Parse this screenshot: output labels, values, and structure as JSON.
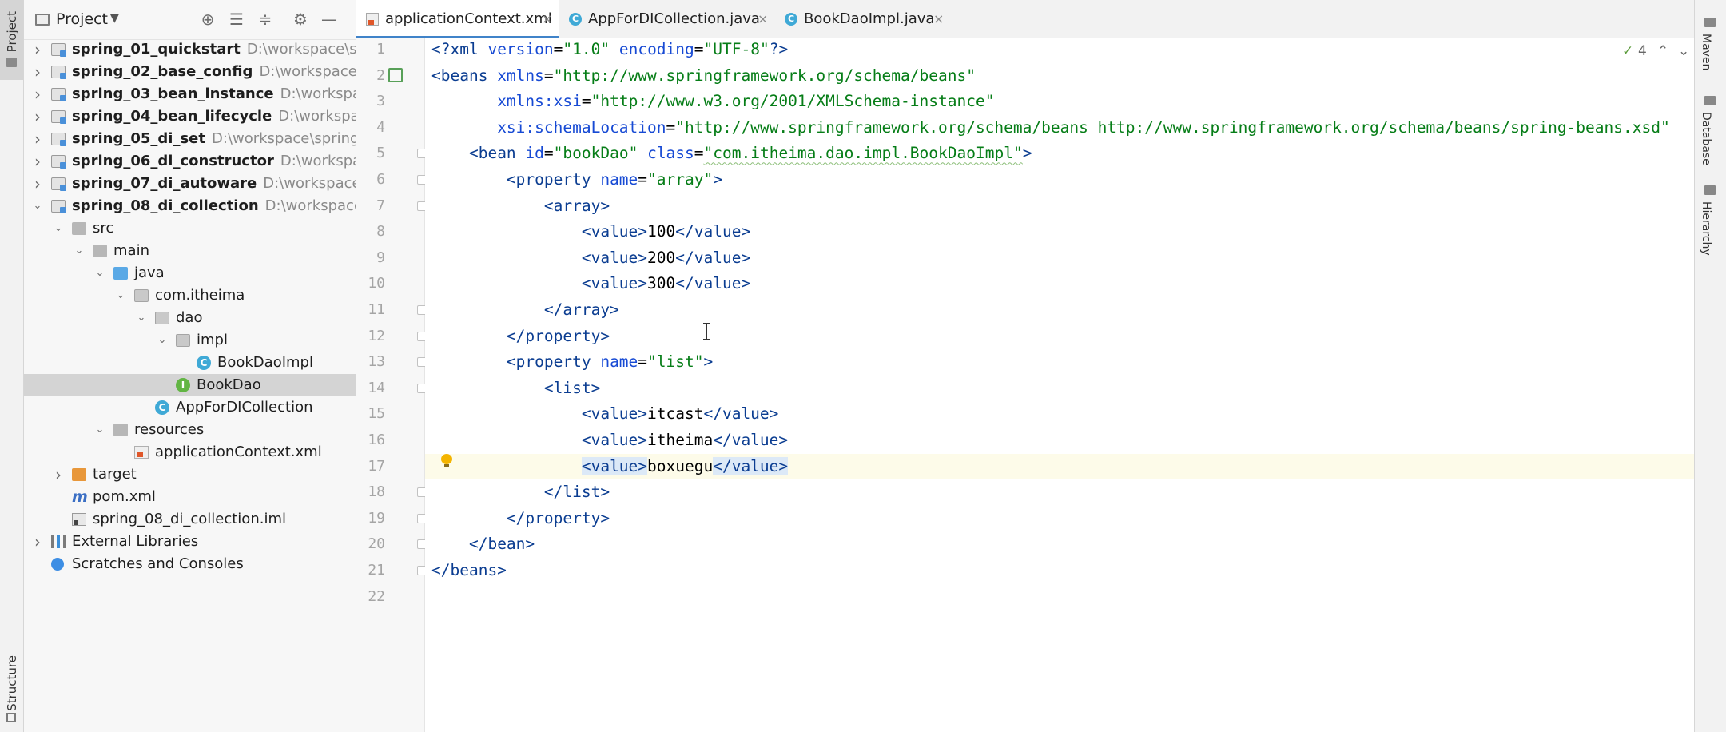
{
  "left_stripe": {
    "project_label": "Project",
    "structure_label": "Structure"
  },
  "project_panel": {
    "title": "Project",
    "tree": [
      {
        "label": "spring_01_quickstart",
        "path": "D:\\workspace\\spri",
        "bold": true,
        "indent": 0,
        "arrow": "right",
        "icon": "module"
      },
      {
        "label": "spring_02_base_config",
        "path": "D:\\workspace\\sp",
        "bold": true,
        "indent": 0,
        "arrow": "right",
        "icon": "module"
      },
      {
        "label": "spring_03_bean_instance",
        "path": "D:\\workspace\\",
        "bold": true,
        "indent": 0,
        "arrow": "right",
        "icon": "module"
      },
      {
        "label": "spring_04_bean_lifecycle",
        "path": "D:\\workspace\\",
        "bold": true,
        "indent": 0,
        "arrow": "right",
        "icon": "module"
      },
      {
        "label": "spring_05_di_set",
        "path": "D:\\workspace\\spring\\s",
        "bold": true,
        "indent": 0,
        "arrow": "right",
        "icon": "module"
      },
      {
        "label": "spring_06_di_constructor",
        "path": "D:\\workspace",
        "bold": true,
        "indent": 0,
        "arrow": "right",
        "icon": "module"
      },
      {
        "label": "spring_07_di_autoware",
        "path": "D:\\workspace\\sp",
        "bold": true,
        "indent": 0,
        "arrow": "right",
        "icon": "module"
      },
      {
        "label": "spring_08_di_collection",
        "path": "D:\\workspace\\s",
        "bold": true,
        "indent": 0,
        "arrow": "down",
        "icon": "module"
      },
      {
        "label": "src",
        "path": "",
        "bold": false,
        "indent": 1,
        "arrow": "down",
        "icon": "folder"
      },
      {
        "label": "main",
        "path": "",
        "bold": false,
        "indent": 2,
        "arrow": "down",
        "icon": "folder"
      },
      {
        "label": "java",
        "path": "",
        "bold": false,
        "indent": 3,
        "arrow": "down",
        "icon": "folder-blue"
      },
      {
        "label": "com.itheima",
        "path": "",
        "bold": false,
        "indent": 4,
        "arrow": "down",
        "icon": "pkg"
      },
      {
        "label": "dao",
        "path": "",
        "bold": false,
        "indent": 5,
        "arrow": "down",
        "icon": "pkg"
      },
      {
        "label": "impl",
        "path": "",
        "bold": false,
        "indent": 6,
        "arrow": "down",
        "icon": "pkg"
      },
      {
        "label": "BookDaoImpl",
        "path": "",
        "bold": false,
        "indent": 7,
        "arrow": "",
        "icon": "class"
      },
      {
        "label": "BookDao",
        "path": "",
        "bold": false,
        "indent": 6,
        "arrow": "",
        "icon": "iface",
        "selected": true
      },
      {
        "label": "AppForDICollection",
        "path": "",
        "bold": false,
        "indent": 5,
        "arrow": "",
        "icon": "class"
      },
      {
        "label": "resources",
        "path": "",
        "bold": false,
        "indent": 3,
        "arrow": "down",
        "icon": "folder"
      },
      {
        "label": "applicationContext.xml",
        "path": "",
        "bold": false,
        "indent": 4,
        "arrow": "",
        "icon": "xml"
      },
      {
        "label": "target",
        "path": "",
        "bold": false,
        "indent": 1,
        "arrow": "right",
        "icon": "folder-orange"
      },
      {
        "label": "pom.xml",
        "path": "",
        "bold": false,
        "indent": 1,
        "arrow": "",
        "icon": "maven"
      },
      {
        "label": "spring_08_di_collection.iml",
        "path": "",
        "bold": false,
        "indent": 1,
        "arrow": "",
        "icon": "iml"
      },
      {
        "label": "External Libraries",
        "path": "",
        "bold": false,
        "indent": 0,
        "arrow": "right",
        "icon": "lib"
      },
      {
        "label": "Scratches and Consoles",
        "path": "",
        "bold": false,
        "indent": 0,
        "arrow": "",
        "icon": "scratch"
      }
    ]
  },
  "tabs": [
    {
      "label": "applicationContext.xml",
      "icon": "xml",
      "active": true
    },
    {
      "label": "AppForDICollection.java",
      "icon": "class",
      "active": false
    },
    {
      "label": "BookDaoImpl.java",
      "icon": "class",
      "active": false
    }
  ],
  "inspection": {
    "count": "4"
  },
  "right_stripe": {
    "maven": "Maven",
    "database": "Database",
    "hierarchy": "Hierarchy"
  },
  "editor": {
    "current_line": 17,
    "lines": [
      [
        [
          "pi",
          "<?xml "
        ],
        [
          "attr",
          "version"
        ],
        [
          "txt",
          "="
        ],
        [
          "val",
          "\"1.0\""
        ],
        [
          "txt",
          " "
        ],
        [
          "attr",
          "encoding"
        ],
        [
          "txt",
          "="
        ],
        [
          "val",
          "\"UTF-8\""
        ],
        [
          "pi",
          "?>"
        ]
      ],
      [
        [
          "tag",
          "<beans "
        ],
        [
          "attr",
          "xmlns"
        ],
        [
          "txt",
          "="
        ],
        [
          "val",
          "\"http://www.springframework.org/schema/beans\""
        ]
      ],
      [
        [
          "txt",
          "       "
        ],
        [
          "attr",
          "xmlns:xsi"
        ],
        [
          "txt",
          "="
        ],
        [
          "val",
          "\"http://www.w3.org/2001/XMLSchema-instance\""
        ]
      ],
      [
        [
          "txt",
          "       "
        ],
        [
          "attr",
          "xsi:schemaLocation"
        ],
        [
          "txt",
          "="
        ],
        [
          "val",
          "\"http://www.springframework.org/schema/beans http://www.springframework.org/schema/beans/spring-beans.xsd\""
        ]
      ],
      [
        [
          "txt",
          "    "
        ],
        [
          "tag",
          "<bean "
        ],
        [
          "attr",
          "id"
        ],
        [
          "txt",
          "="
        ],
        [
          "val",
          "\"bookDao\""
        ],
        [
          "txt",
          " "
        ],
        [
          "attr",
          "class"
        ],
        [
          "txt",
          "="
        ],
        [
          "val",
          "\"com.itheima.dao.impl.BookDaoImpl\""
        ],
        [
          "tag",
          ">"
        ]
      ],
      [
        [
          "txt",
          "        "
        ],
        [
          "tag",
          "<property "
        ],
        [
          "attr",
          "name"
        ],
        [
          "txt",
          "="
        ],
        [
          "val",
          "\"array\""
        ],
        [
          "tag",
          ">"
        ]
      ],
      [
        [
          "txt",
          "            "
        ],
        [
          "tag",
          "<array>"
        ]
      ],
      [
        [
          "txt",
          "                "
        ],
        [
          "tag",
          "<value>"
        ],
        [
          "txt",
          "100"
        ],
        [
          "tag",
          "</value>"
        ]
      ],
      [
        [
          "txt",
          "                "
        ],
        [
          "tag",
          "<value>"
        ],
        [
          "txt",
          "200"
        ],
        [
          "tag",
          "</value>"
        ]
      ],
      [
        [
          "txt",
          "                "
        ],
        [
          "tag",
          "<value>"
        ],
        [
          "txt",
          "300"
        ],
        [
          "tag",
          "</value>"
        ]
      ],
      [
        [
          "txt",
          "            "
        ],
        [
          "tag",
          "</array>"
        ]
      ],
      [
        [
          "txt",
          "        "
        ],
        [
          "tag",
          "</property>"
        ]
      ],
      [
        [
          "txt",
          "        "
        ],
        [
          "tag",
          "<property "
        ],
        [
          "attr",
          "name"
        ],
        [
          "txt",
          "="
        ],
        [
          "val",
          "\"list\""
        ],
        [
          "tag",
          ">"
        ]
      ],
      [
        [
          "txt",
          "            "
        ],
        [
          "tag",
          "<list>"
        ]
      ],
      [
        [
          "txt",
          "                "
        ],
        [
          "tag",
          "<value>"
        ],
        [
          "txt",
          "itcast"
        ],
        [
          "tag",
          "</value>"
        ]
      ],
      [
        [
          "txt",
          "                "
        ],
        [
          "tag",
          "<value>"
        ],
        [
          "txt",
          "itheima"
        ],
        [
          "tag",
          "</value>"
        ]
      ],
      [
        [
          "txt",
          "                "
        ],
        [
          "hltag",
          "<value>"
        ],
        [
          "txt",
          "boxuegu"
        ],
        [
          "hltag",
          "</value>"
        ]
      ],
      [
        [
          "txt",
          "            "
        ],
        [
          "tag",
          "</list>"
        ]
      ],
      [
        [
          "txt",
          "        "
        ],
        [
          "tag",
          "</property>"
        ]
      ],
      [
        [
          "txt",
          "    "
        ],
        [
          "tag",
          "</bean>"
        ]
      ],
      [
        [
          "tag",
          "</beans>"
        ]
      ],
      []
    ]
  }
}
